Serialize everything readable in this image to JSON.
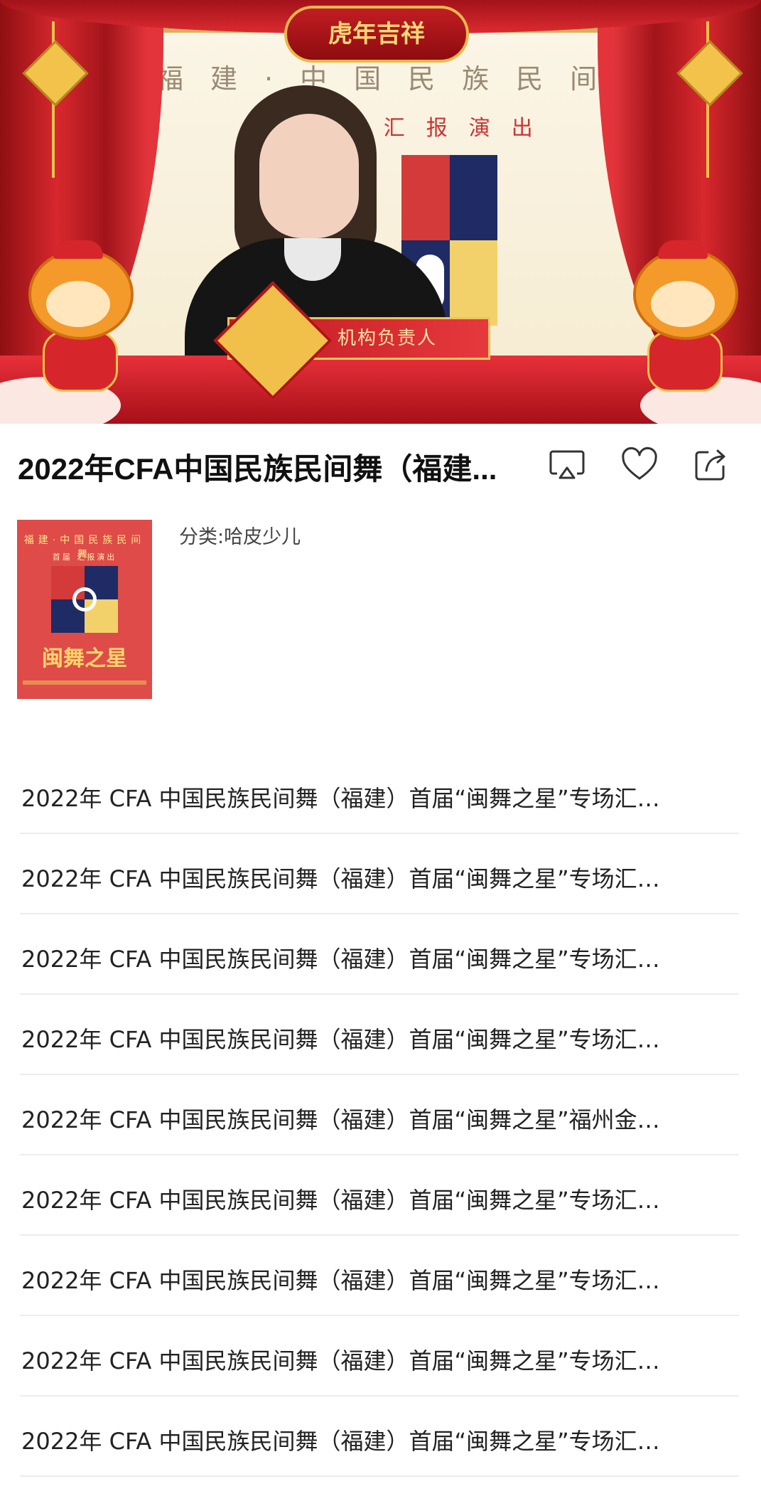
{
  "video": {
    "logo_text": "虎年吉祥",
    "banner_line1": "福建·中国民族民间舞",
    "banner_line2": "首届 汇报演出",
    "caption": "机构负责人"
  },
  "title": "2022年CFA中国民族民间舞（福建...",
  "actions": {
    "airplay_icon": "airplay-icon",
    "favorite_icon": "heart-icon",
    "share_icon": "share-icon"
  },
  "info": {
    "cover": {
      "line1": "福建·中国民族民间舞",
      "line2": "首届 汇报演出",
      "name": "闽舞之星"
    },
    "category": "分类:哈皮少儿"
  },
  "episodes": [
    "2022年 CFA 中国民族民间舞（福建）首届“闽舞之星”专场汇…",
    "2022年 CFA 中国民族民间舞（福建）首届“闽舞之星”专场汇…",
    "2022年 CFA 中国民族民间舞（福建）首届“闽舞之星”专场汇…",
    "2022年 CFA 中国民族民间舞（福建）首届“闽舞之星”专场汇…",
    "2022年 CFA 中国民族民间舞（福建）首届“闽舞之星”福州金…",
    "2022年 CFA 中国民族民间舞（福建）首届“闽舞之星”专场汇…",
    "2022年 CFA 中国民族民间舞（福建）首届“闽舞之星”专场汇…",
    "2022年 CFA 中国民族民间舞（福建）首届“闽舞之星”专场汇…",
    "2022年 CFA 中国民族民间舞（福建）首届“闽舞之星”专场汇…"
  ]
}
